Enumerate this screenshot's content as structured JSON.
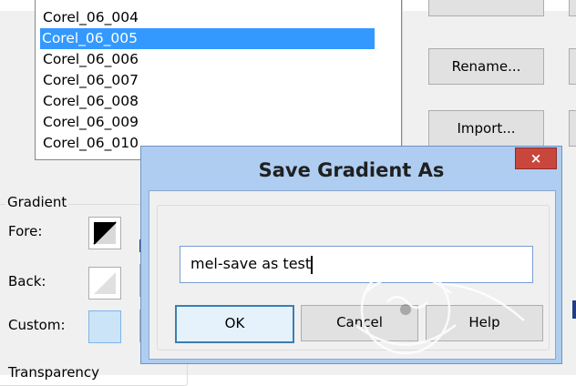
{
  "gradient_list": {
    "items": [
      "Corel_06_004",
      "Corel_06_005",
      "Corel_06_006",
      "Corel_06_007",
      "Corel_06_008",
      "Corel_06_009",
      "Corel_06_010"
    ],
    "selected_index": 1
  },
  "side_buttons": {
    "rename_label": "Rename...",
    "import_label": "Import..."
  },
  "gradient_group": {
    "title": "Gradient",
    "fore_label": "Fore:",
    "back_label": "Back:",
    "custom_label": "Custom:",
    "transparency_label": "Transparency"
  },
  "save_dialog": {
    "title": "Save Gradient As",
    "close_glyph": "×",
    "name_value": "mel-save as test",
    "ok_label": "OK",
    "cancel_label": "Cancel",
    "help_label": "Help"
  },
  "colors": {
    "selection": "#3399ff",
    "dialog_frame": "#aecdf1",
    "close_button": "#c9463d",
    "custom_swatch": "#cce4f7"
  }
}
